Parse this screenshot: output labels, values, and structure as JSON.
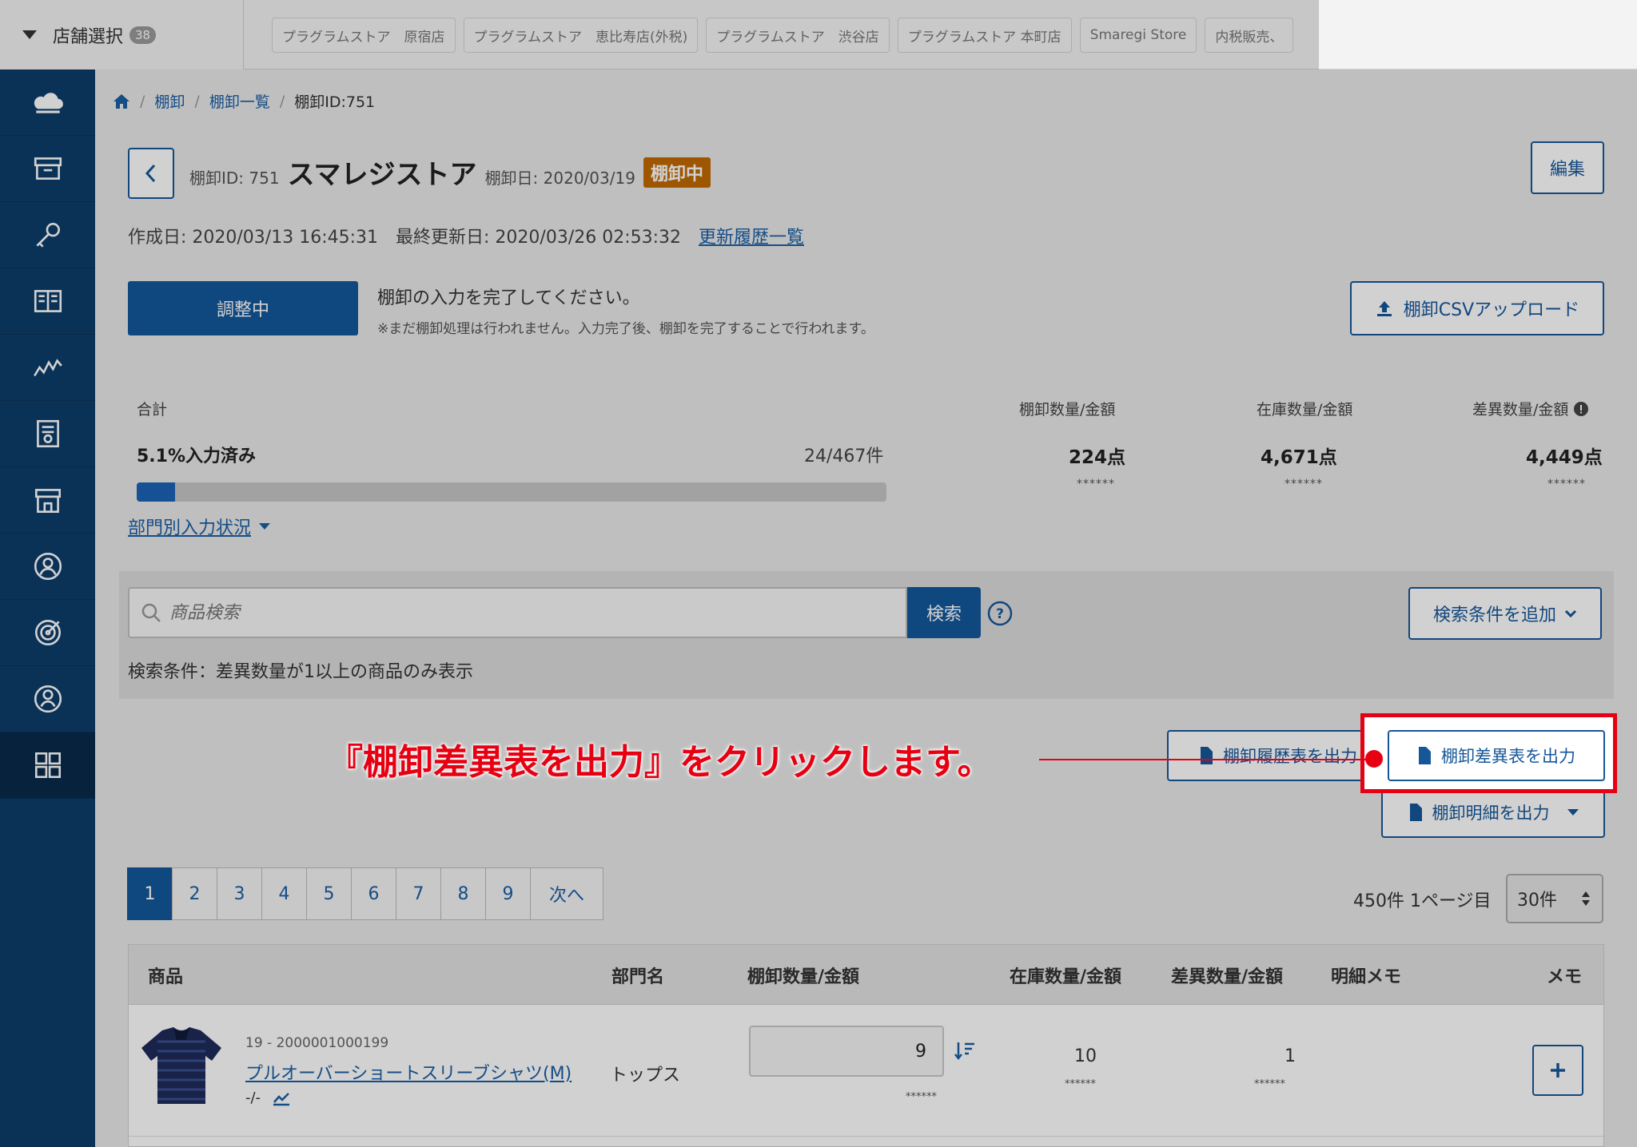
{
  "topbar": {
    "store_select_label": "店舗選択",
    "store_count": "38",
    "store_tabs": [
      "プラグラムストア　原宿店",
      "プラグラムストア　恵比寿店(外税)",
      "プラグラムストア　渋谷店",
      "プラグラムストア 本町店",
      "Smaregi Store",
      "内税販売、"
    ],
    "icons": [
      "bell-icon",
      "help-circle-icon",
      "megaphone-icon",
      "cart-icon"
    ]
  },
  "sidebar": {
    "items": [
      "cloud-icon",
      "archive-icon",
      "key-icon",
      "book-icon",
      "chart-line-icon",
      "report-icon",
      "store-icon",
      "user-circle-icon",
      "target-icon",
      "person-icon",
      "grid-icon"
    ]
  },
  "breadcrumb": {
    "items": [
      "棚卸",
      "棚卸一覧",
      "棚卸ID:751"
    ]
  },
  "header": {
    "id_label": "棚卸ID: 751",
    "store_name": "スマレジストア",
    "date_label": "棚卸日: 2020/03/19",
    "status_badge": "棚卸中",
    "edit_label": "編集"
  },
  "dates": {
    "created": "作成日: 2020/03/13 16:45:31",
    "updated": "最終更新日: 2020/03/26 02:53:32",
    "history_link": "更新履歴一覧"
  },
  "status": {
    "button_label": "調整中",
    "message": "棚卸の入力を完了してください。",
    "note": "※まだ棚卸処理は行われません。入力完了後、棚卸を完了することで行われます。",
    "csv_upload_label": "棚卸CSVアップロード"
  },
  "summary": {
    "total_label": "合計",
    "progress_text": "5.1%入力済み",
    "progress_fraction": 0.051,
    "count_text": "24/467件",
    "col_stock_take": "棚卸数量/金額",
    "col_inventory": "在庫数量/金額",
    "col_diff": "差異数量/金額",
    "stock_take_value": "224点",
    "inventory_value": "4,671点",
    "diff_value": "4,449点",
    "masked": "******",
    "dept_link": "部門別入力状況"
  },
  "search": {
    "placeholder": "商品検索",
    "button_label": "検索",
    "add_condition_label": "検索条件を追加",
    "condition_text": "検索条件：差異数量が1以上の商品のみ表示"
  },
  "outputs": {
    "history_label": "棚卸履歴表を出力",
    "diff_label": "棚卸差異表を出力",
    "detail_label": "棚卸明細を出力"
  },
  "callout": {
    "text": "『棚卸差異表を出力』をクリックします。"
  },
  "pagination": {
    "pages": [
      "1",
      "2",
      "3",
      "4",
      "5",
      "6",
      "7",
      "8",
      "9"
    ],
    "next_label": "次へ",
    "info": "450件 1ページ目",
    "per_page": "30件"
  },
  "table": {
    "headers": {
      "product": "商品",
      "dept": "部門名",
      "stock_take": "棚卸数量/金額",
      "inventory": "在庫数量/金額",
      "diff": "差異数量/金額",
      "detail_memo": "明細メモ",
      "memo": "メモ"
    },
    "rows": [
      {
        "code": "19 - 2000001000199",
        "name": "プルオーバーショートスリーブシャツ(M)",
        "sub": "-/-",
        "dept": "トップス",
        "stock_take": "9",
        "inventory": "10",
        "diff": "1",
        "masked": "******"
      }
    ]
  }
}
